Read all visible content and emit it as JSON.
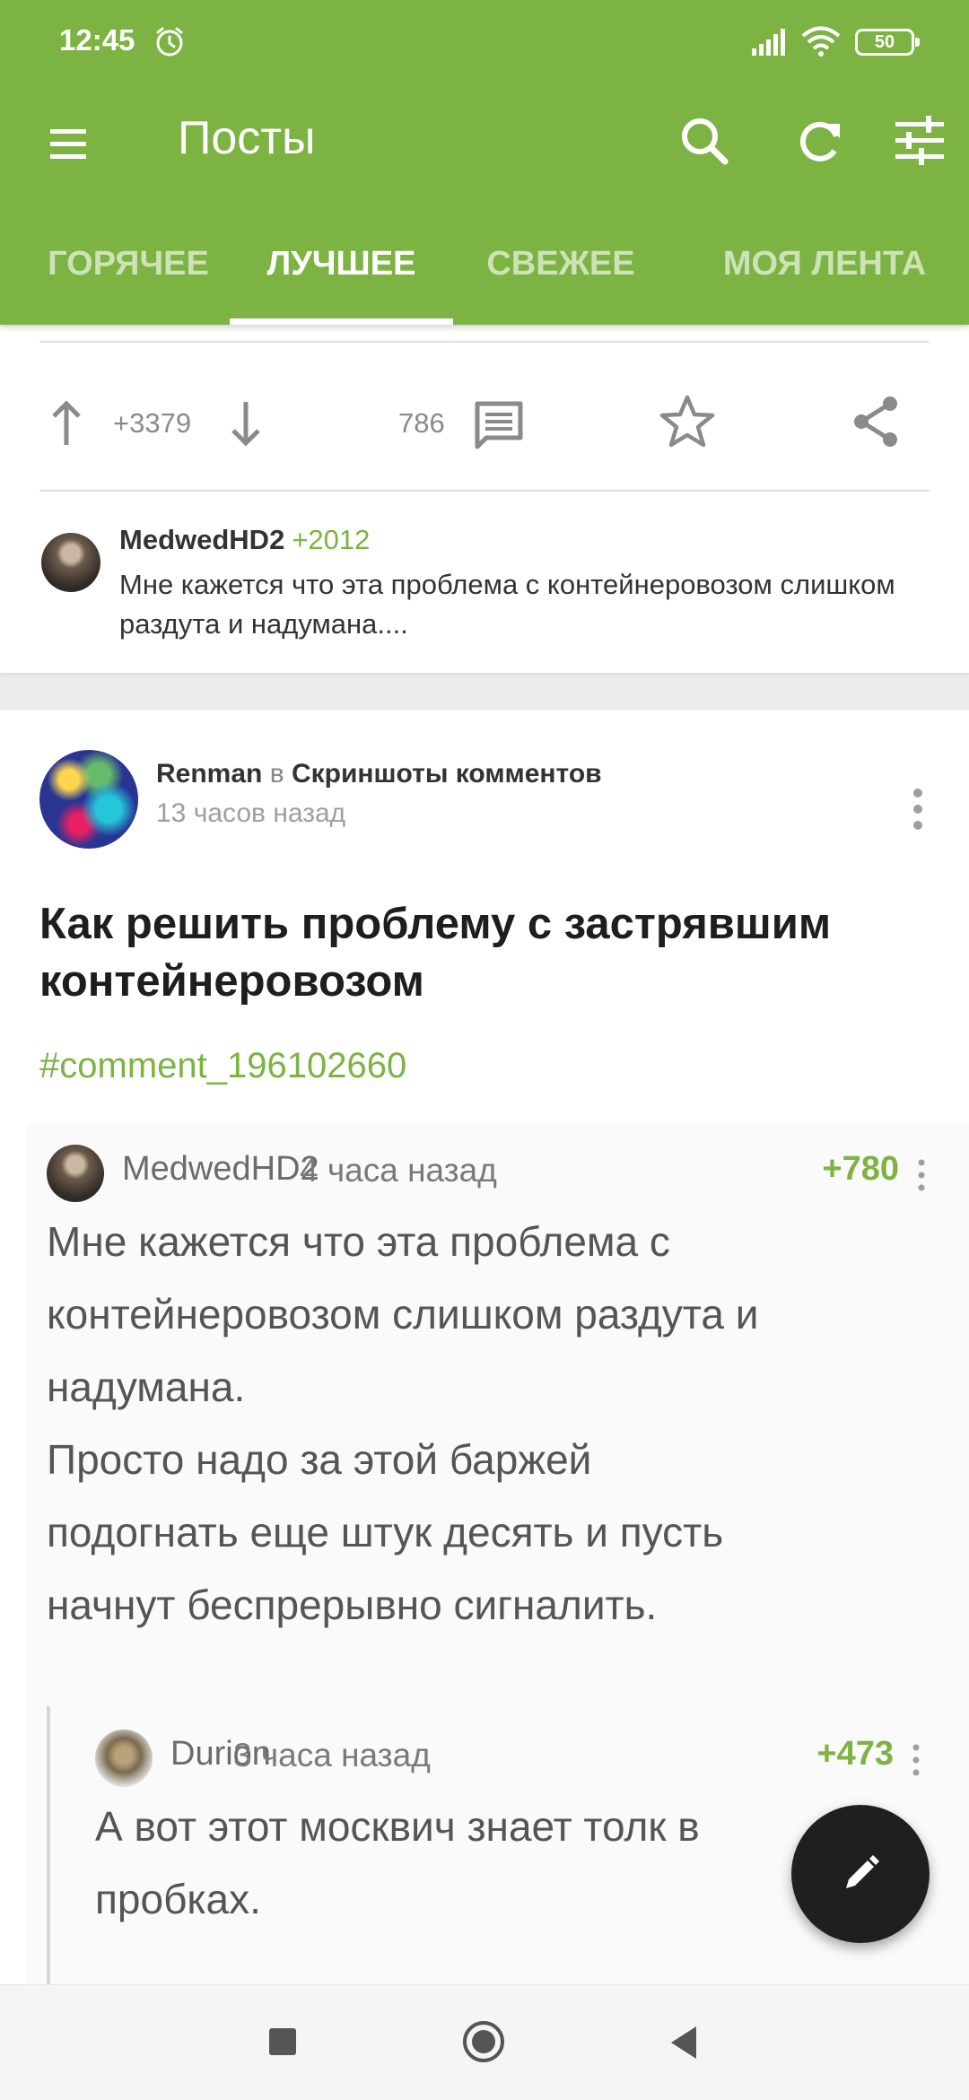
{
  "status_bar": {
    "time": "12:45",
    "battery": "50"
  },
  "toolbar": {
    "title": "Посты"
  },
  "tabs": [
    {
      "label": "ГОРЯЧЕЕ",
      "active": false
    },
    {
      "label": "ЛУЧШЕЕ",
      "active": true
    },
    {
      "label": "СВЕЖЕЕ",
      "active": false
    },
    {
      "label": "МОЯ ЛЕНТА",
      "active": false
    }
  ],
  "prev_post": {
    "rating": "+3379",
    "comments_count": "786",
    "top_comment": {
      "author": "MedwedHD2",
      "score": "+2012",
      "text": "Мне кажется что эта проблема с контейнеровозом слишком раздута и надумана...."
    }
  },
  "post": {
    "author": "Renman",
    "in_word": "в",
    "community": "Скриншоты комментов",
    "time": "13 часов назад",
    "title": "Как решить проблему с застрявшим контейнеровозом",
    "tag": "#comment_196102660"
  },
  "screenshot": {
    "comment1": {
      "author": "MedwedHD2",
      "time": "4 часа назад",
      "score": "+780",
      "text": "Мне кажется что эта проблема с\nконтейнеровозом слишком раздута и\nнадумана.\nПросто надо за этой баржей\nподогнать еще штук десять и пусть\nначнут беспрерывно сигналить."
    },
    "comment2": {
      "author": "Durion",
      "time": "3 часа назад",
      "score": "+473",
      "text": "А вот этот москвич знает толк в\nпробках."
    }
  },
  "colors": {
    "accent": "#7cb342",
    "fab": "#1f1f1f"
  }
}
